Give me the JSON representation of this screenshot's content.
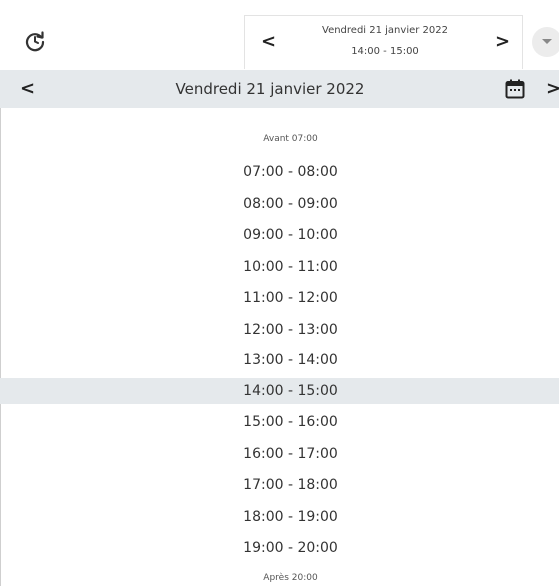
{
  "header": {
    "refresh_icon": "refresh-icon",
    "picker": {
      "prev_label": "<",
      "next_label": ">",
      "date": "Vendredi 21 janvier 2022",
      "time": "14:00 - 15:00"
    },
    "dropdown_icon": "chevron-down-icon"
  },
  "day_nav": {
    "prev_label": "<",
    "next_label": ">",
    "title": "Vendredi 21 janvier 2022",
    "calendar_icon": "calendar-icon"
  },
  "slots": {
    "before_label": "Avant 07:00",
    "after_label": "Après 20:00",
    "items": [
      "07:00 - 08:00",
      "08:00 - 09:00",
      "09:00 - 10:00",
      "10:00 - 11:00",
      "11:00 - 12:00",
      "12:00 - 13:00",
      "13:00 - 14:00",
      "14:00 - 15:00",
      "15:00 - 16:00",
      "16:00 - 17:00",
      "17:00 - 18:00",
      "18:00 - 19:00",
      "19:00 - 20:00"
    ],
    "selected": "14:00 - 15:00"
  },
  "colors": {
    "highlight": "#e5e9ec",
    "text": "#333333"
  }
}
